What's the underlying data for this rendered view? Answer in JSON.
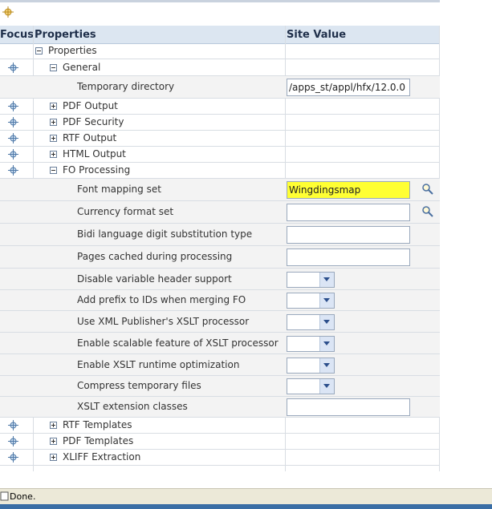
{
  "header": {
    "focus": "Focus",
    "properties": "Properties",
    "site_value": "Site Value"
  },
  "rows": [
    {
      "label": "Properties",
      "toggle": "minus",
      "indent": 1,
      "focus": false,
      "h": 20
    },
    {
      "label": "General",
      "toggle": "minus",
      "indent": 2,
      "focus": true,
      "h": 21
    },
    {
      "label": "Temporary directory",
      "toggle": "",
      "indent": 3,
      "focus": false,
      "h": 28,
      "field": "text",
      "value": "/apps_st/appl/hfx/12.0.0"
    },
    {
      "label": "PDF Output",
      "toggle": "plus",
      "indent": 2,
      "focus": true,
      "h": 20
    },
    {
      "label": "PDF Security",
      "toggle": "plus",
      "indent": 2,
      "focus": true,
      "h": 20
    },
    {
      "label": "RTF Output",
      "toggle": "plus",
      "indent": 2,
      "focus": true,
      "h": 20
    },
    {
      "label": "HTML Output",
      "toggle": "plus",
      "indent": 2,
      "focus": true,
      "h": 20
    },
    {
      "label": "FO Processing",
      "toggle": "minus",
      "indent": 2,
      "focus": true,
      "h": 20
    },
    {
      "label": "Font mapping set",
      "toggle": "",
      "indent": 3,
      "focus": false,
      "h": 28,
      "field": "lov",
      "value": "Wingdingsmap",
      "highlight": true
    },
    {
      "label": "Currency format set",
      "toggle": "",
      "indent": 3,
      "focus": false,
      "h": 28,
      "field": "lov",
      "value": ""
    },
    {
      "label": "Bidi language digit substitution type",
      "toggle": "",
      "indent": 3,
      "focus": false,
      "h": 28,
      "field": "text",
      "value": ""
    },
    {
      "label": "Pages cached during processing",
      "toggle": "",
      "indent": 3,
      "focus": false,
      "h": 28,
      "field": "text",
      "value": ""
    },
    {
      "label": "Disable variable header support",
      "toggle": "",
      "indent": 3,
      "focus": false,
      "h": 27,
      "field": "select",
      "value": ""
    },
    {
      "label": "Add prefix to IDs when merging FO",
      "toggle": "",
      "indent": 3,
      "focus": false,
      "h": 26,
      "field": "select",
      "value": ""
    },
    {
      "label": "Use XML Publisher's XSLT processor",
      "toggle": "",
      "indent": 3,
      "focus": false,
      "h": 27,
      "field": "select",
      "value": ""
    },
    {
      "label": "Enable scalable feature of XSLT processor",
      "toggle": "",
      "indent": 3,
      "focus": false,
      "h": 27,
      "field": "select",
      "value": ""
    },
    {
      "label": "Enable XSLT runtime optimization",
      "toggle": "",
      "indent": 3,
      "focus": false,
      "h": 27,
      "field": "select",
      "value": ""
    },
    {
      "label": "Compress temporary files",
      "toggle": "",
      "indent": 3,
      "focus": false,
      "h": 26,
      "field": "select",
      "value": ""
    },
    {
      "label": "XSLT extension classes",
      "toggle": "",
      "indent": 3,
      "focus": false,
      "h": 26,
      "field": "text",
      "value": ""
    },
    {
      "label": "RTF Templates",
      "toggle": "plus",
      "indent": 2,
      "focus": true,
      "h": 20
    },
    {
      "label": "PDF Templates",
      "toggle": "plus",
      "indent": 2,
      "focus": true,
      "h": 20
    },
    {
      "label": "XLIFF Extraction",
      "toggle": "plus",
      "indent": 2,
      "focus": true,
      "h": 20
    }
  ],
  "status": {
    "text": "Done."
  },
  "icons": {
    "focus": "focus-crosshair-icon",
    "lov": "search-icon",
    "page": "page-icon"
  },
  "colors": {
    "header_bg": "#dce6f1",
    "highlight": "#ffff33",
    "status_bg": "#ece9d8"
  }
}
